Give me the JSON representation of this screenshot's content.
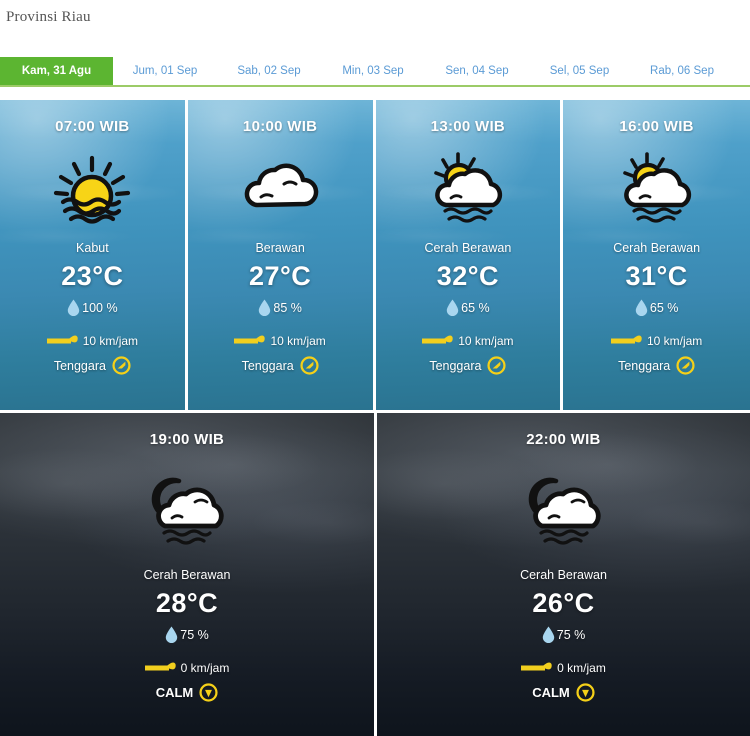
{
  "header": {
    "title": "Provinsi Riau"
  },
  "tabs": [
    {
      "label": "Kam, 31 Agu",
      "active": true
    },
    {
      "label": "Jum, 01 Sep",
      "active": false
    },
    {
      "label": "Sab, 02 Sep",
      "active": false
    },
    {
      "label": "Min, 03 Sep",
      "active": false
    },
    {
      "label": "Sen, 04 Sep",
      "active": false
    },
    {
      "label": "Sel, 05 Sep",
      "active": false
    },
    {
      "label": "Rab, 06 Sep",
      "active": false
    }
  ],
  "colors": {
    "tab_active_bg": "#5cb531",
    "tab_text": "#5b9bd5",
    "tab_underline": "#9ccb67",
    "title_text": "#555555",
    "day_card_bg": "#3f93bd",
    "night_card_bg": "#20262e",
    "icon_yellow": "#f5d018",
    "droplet_blue": "#a9d6ef",
    "wind_yellow": "#f2cf1e"
  },
  "forecast": [
    {
      "time": "07:00 WIB",
      "icon": "fog-sun-icon",
      "condition": "Kabut",
      "temperature": "23°C",
      "humidity": "100 %",
      "wind_speed": "10 km/jam",
      "wind_direction": "Tenggara",
      "period": "day"
    },
    {
      "time": "10:00 WIB",
      "icon": "cloudy-icon",
      "condition": "Berawan",
      "temperature": "27°C",
      "humidity": "85 %",
      "wind_speed": "10 km/jam",
      "wind_direction": "Tenggara",
      "period": "day"
    },
    {
      "time": "13:00 WIB",
      "icon": "partly-cloudy-day-icon",
      "condition": "Cerah Berawan",
      "temperature": "32°C",
      "humidity": "65 %",
      "wind_speed": "10 km/jam",
      "wind_direction": "Tenggara",
      "period": "day"
    },
    {
      "time": "16:00 WIB",
      "icon": "partly-cloudy-day-icon",
      "condition": "Cerah Berawan",
      "temperature": "31°C",
      "humidity": "65 %",
      "wind_speed": "10 km/jam",
      "wind_direction": "Tenggara",
      "period": "day"
    },
    {
      "time": "19:00 WIB",
      "icon": "partly-cloudy-night-icon",
      "condition": "Cerah Berawan",
      "temperature": "28°C",
      "humidity": "75 %",
      "wind_speed": "0 km/jam",
      "wind_direction": "CALM",
      "period": "night"
    },
    {
      "time": "22:00 WIB",
      "icon": "partly-cloudy-night-icon",
      "condition": "Cerah Berawan",
      "temperature": "26°C",
      "humidity": "75 %",
      "wind_speed": "0 km/jam",
      "wind_direction": "CALM",
      "period": "night"
    }
  ]
}
